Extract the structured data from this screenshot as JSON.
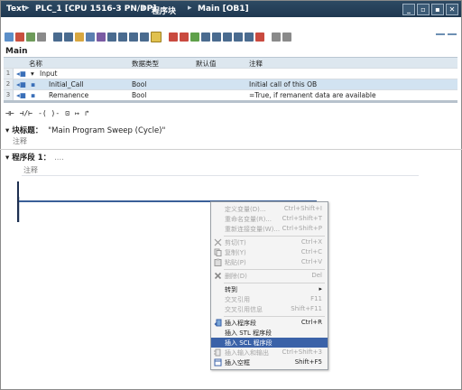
{
  "titlebar": {
    "crumbs": [
      "Text",
      "PLC_1 [CPU 1516-3 PN/DP]",
      "程序块",
      "Main [OB1]"
    ],
    "separator": "▸",
    "buttons": [
      "_",
      "▫",
      "▪",
      "✕"
    ]
  },
  "block": {
    "name": "Main"
  },
  "interface_table": {
    "headers": [
      "名称",
      "数据类型",
      "默认值",
      "注释"
    ],
    "rows": [
      {
        "num": "1",
        "name": "Input",
        "type": "",
        "default": "",
        "comment": ""
      },
      {
        "num": "2",
        "name": "Initial_Call",
        "type": "Bool",
        "default": "",
        "comment": "Initial call of this OB"
      },
      {
        "num": "3",
        "name": "Remanence",
        "type": "Bool",
        "default": "",
        "comment": "=True, if remanent data are available"
      }
    ]
  },
  "ladder_toolbar": [
    "⊣⊢",
    "⊣/⊢",
    "-( )-",
    "⊡",
    "↦",
    "↱"
  ],
  "block_title": {
    "label": "块标题：",
    "value": "\"Main Program Sweep (Cycle)\""
  },
  "block_comment": "注释",
  "network": {
    "label": "程序段 1：",
    "dots": "....",
    "comment": "注释"
  },
  "context_menu": {
    "items": [
      {
        "label": "定义变量(D)...",
        "shortcut": "Ctrl+Shift+I",
        "disabled": true,
        "icon": ""
      },
      {
        "label": "重命名变量(R)...",
        "shortcut": "Ctrl+Shift+T",
        "disabled": true,
        "icon": ""
      },
      {
        "label": "重新连接变量(W)...",
        "shortcut": "Ctrl+Shift+P",
        "disabled": true,
        "icon": ""
      },
      {
        "label": "剪切(T)",
        "shortcut": "Ctrl+X",
        "disabled": true,
        "icon": "cut-icon"
      },
      {
        "label": "复制(Y)",
        "shortcut": "Ctrl+C",
        "disabled": true,
        "icon": "copy-icon"
      },
      {
        "label": "粘贴(P)",
        "shortcut": "Ctrl+V",
        "disabled": true,
        "icon": "paste-icon"
      },
      {
        "label": "删除(D)",
        "shortcut": "Del",
        "disabled": true,
        "icon": "delete-icon"
      },
      {
        "label": "转到",
        "shortcut": "▸",
        "disabled": false,
        "icon": ""
      },
      {
        "label": "交叉引用",
        "shortcut": "F11",
        "disabled": true,
        "icon": ""
      },
      {
        "label": "交叉引用信息",
        "shortcut": "Shift+F11",
        "disabled": true,
        "icon": ""
      },
      {
        "label": "插入程序段",
        "shortcut": "Ctrl+R",
        "disabled": false,
        "icon": "insert-network-icon"
      },
      {
        "label": "插入 STL 程序段",
        "shortcut": "",
        "disabled": false,
        "icon": ""
      },
      {
        "label": "插入 SCL 程序段",
        "shortcut": "",
        "disabled": false,
        "icon": "",
        "highlighted": true
      },
      {
        "label": "插入输入和输出",
        "shortcut": "Ctrl+Shift+3",
        "disabled": true,
        "icon": "insert-io-icon"
      },
      {
        "label": "插入空框",
        "shortcut": "Shift+F5",
        "disabled": false,
        "icon": "empty-box-icon"
      }
    ]
  },
  "colors": {
    "titlebar": "#1f3850",
    "highlight": "#3a62a8",
    "rung": "#3a5f98"
  }
}
